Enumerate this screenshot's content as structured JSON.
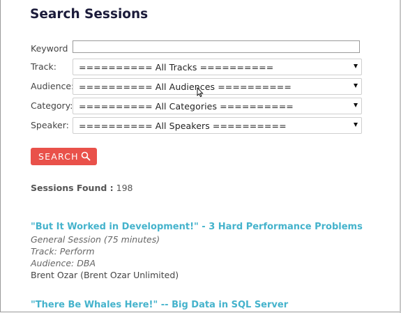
{
  "page": {
    "title": "Search Sessions"
  },
  "form": {
    "keyword": {
      "label": "Keyword",
      "value": "",
      "placeholder": ""
    },
    "track": {
      "label": "Track:",
      "selected": "========== All Tracks =========="
    },
    "audience": {
      "label": "Audience:",
      "selected": "========== All Audiences =========="
    },
    "category": {
      "label": "Category:",
      "selected": "========== All Categories =========="
    },
    "speaker": {
      "label": "Speaker:",
      "selected": "========== All Speakers =========="
    }
  },
  "search_button": {
    "label": "SEARCH",
    "icon": "search-icon",
    "color": "#e9514a"
  },
  "results": {
    "found_label": "Sessions Found :",
    "found_count": "198",
    "sessions": [
      {
        "title": "\"But It Worked in Development!\" - 3 Hard Performance Problems",
        "type": "General Session (75 minutes)",
        "track": "Track: Perform",
        "audience": "Audience: DBA",
        "speaker": "Brent Ozar (Brent Ozar Unlimited)"
      },
      {
        "title": "\"There Be Whales Here!\" -- Big Data in SQL Server"
      }
    ]
  },
  "colors": {
    "link": "#45b3cc",
    "heading": "#1b1b3a",
    "accent": "#e9514a"
  }
}
